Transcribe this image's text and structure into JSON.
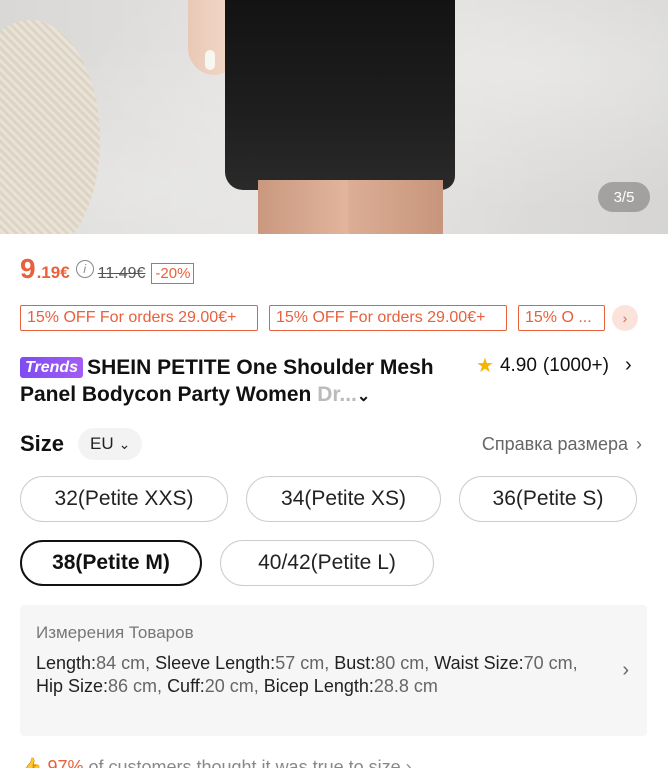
{
  "gallery": {
    "counter": "3/5"
  },
  "price": {
    "main": "9",
    "decimal": ".19€",
    "info_icon": "i",
    "original": "11.49€",
    "discount": "-20%"
  },
  "coupons": [
    "15% OFF For orders 29.00€+",
    "15% OFF For orders 29.00€+",
    "15% O ..."
  ],
  "coupon_more_icon": "›",
  "product": {
    "badge": "Trends",
    "title_main": "SHEIN PETITE One Shoulder Mesh Panel Bodycon Party Women ",
    "title_fade": "Dr...",
    "expand_icon": "⌄"
  },
  "rating": {
    "score": "4.90",
    "count": "(1000+)",
    "chevron": "›"
  },
  "size": {
    "label": "Size",
    "region": "EU",
    "region_chevron": "⌄",
    "guide": "Справка размера",
    "guide_chevron": "›",
    "options": [
      "32(Petite XXS)",
      "34(Petite XS)",
      "36(Petite S)",
      "38(Petite M)",
      "40/42(Petite L)"
    ],
    "selected": "38(Petite M)"
  },
  "measurements": {
    "title": "Измерения Товаров",
    "parts": [
      {
        "k": "Length:",
        "v": "84 cm, "
      },
      {
        "k": "Sleeve Length:",
        "v": "57 cm, "
      },
      {
        "k": "Bust:",
        "v": "80 cm, "
      },
      {
        "k": "Waist Size:",
        "v": "70 cm, "
      },
      {
        "k": "Hip Size:",
        "v": "86 cm, "
      },
      {
        "k": "Cuff:",
        "v": "20 cm, "
      },
      {
        "k": "Bicep Length:",
        "v": "28.8 cm"
      }
    ],
    "chevron": "›"
  },
  "fit": {
    "pct": "97%",
    "text": " of customers thought it was true to size ›"
  }
}
